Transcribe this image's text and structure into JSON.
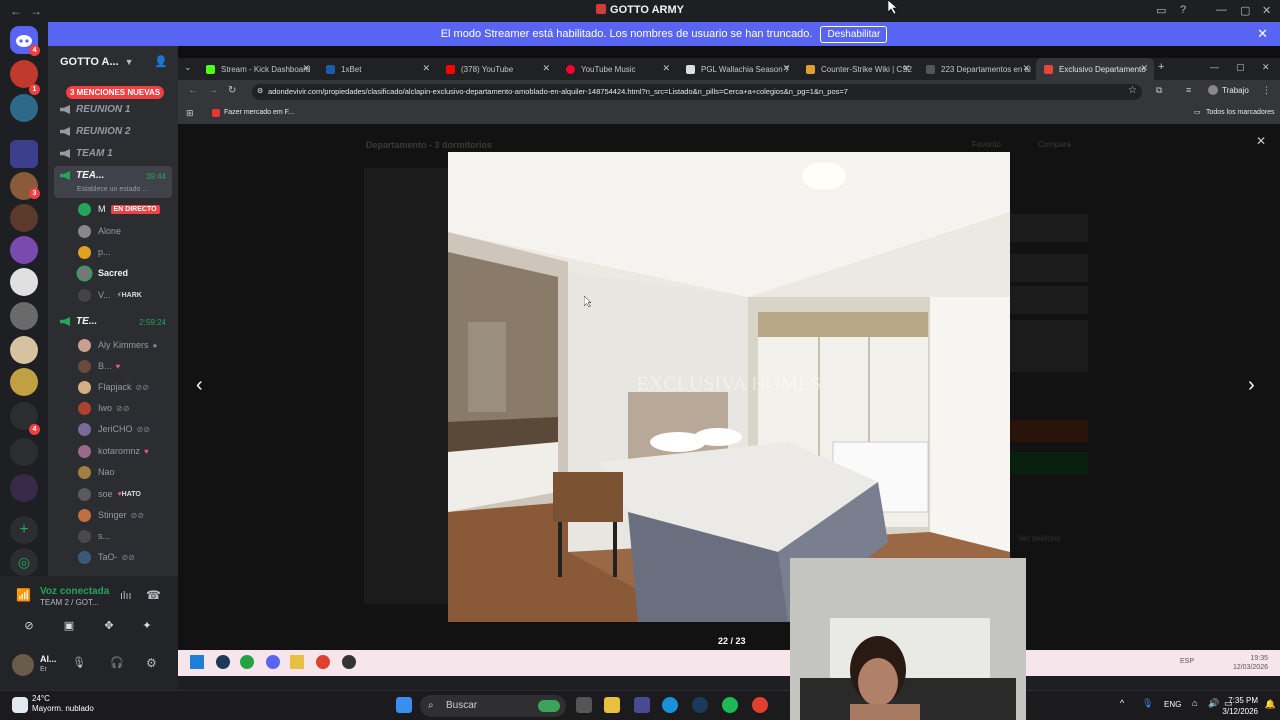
{
  "window": {
    "title": "GOTTO ARMY"
  },
  "banner": {
    "text": "El modo Streamer está habilitado. Los nombres de usuario se han truncado.",
    "button": "Deshabilitar"
  },
  "servers": {
    "badges": [
      "4",
      "1",
      "3",
      "4"
    ],
    "home_badge": "4"
  },
  "guild": {
    "name": "GOTTO A...",
    "mentions": "3 MENCIONES NUEVAS"
  },
  "voice_channels": [
    {
      "name": "REUNION 1"
    },
    {
      "name": "REUNION 2"
    },
    {
      "name": "TEAM 1"
    },
    {
      "name": "TEA...",
      "timer": "39:44",
      "status": "Establece un estado ..."
    },
    {
      "name": "TE...",
      "timer": "2:59:24"
    }
  ],
  "users_a": [
    {
      "name": "M",
      "badge": "EN DIRECTO"
    },
    {
      "name": "Alone"
    },
    {
      "name": "p..."
    },
    {
      "name": "Sacred"
    },
    {
      "name": "V...",
      "tag": "HARK"
    }
  ],
  "users_b": [
    {
      "name": "Aly Kimmers"
    },
    {
      "name": "B..."
    },
    {
      "name": "Flapjack"
    },
    {
      "name": "Iwo"
    },
    {
      "name": "JeriCHO"
    },
    {
      "name": "kotaromnz"
    },
    {
      "name": "Nao"
    },
    {
      "name": "soe",
      "tag": "HATO"
    },
    {
      "name": "Stinger"
    },
    {
      "name": "s..."
    },
    {
      "name": "TaO-"
    }
  ],
  "voice_panel": {
    "status": "Voz conectada",
    "channel": "TEAM 2 / GOT...",
    "user": "Al...",
    "user_sub": "Er"
  },
  "browser": {
    "tabs": [
      {
        "label": "Stream - Kick Dashboard",
        "color": "#53fc18"
      },
      {
        "label": "1xBet",
        "color": "#1d5cad"
      },
      {
        "label": "(378) YouTube",
        "color": "#ff0000"
      },
      {
        "label": "YouTube Music",
        "color": "#ff0033"
      },
      {
        "label": "PGL Wallachia Season 7",
        "color": "#ffffff"
      },
      {
        "label": "Counter-Strike Wiki | CS2",
        "color": "#e0a030"
      },
      {
        "label": "223 Departamentos en al",
        "color": "#444"
      },
      {
        "label": "Exclusivo Departamento",
        "color": "#e8443a"
      }
    ],
    "url": "adondevivir.com/propiedades/clasificado/alclapin-exclusivo-departamento-amoblado-en-alquiler-148754424.html?n_src=Listado&n_pills=Cerca+a+colegios&n_pg=1&n_pos=7",
    "profile": "Trabajo",
    "bookmark": "Fazer mercado em F...",
    "all_bookmarks": "Todos los marcadores"
  },
  "listing": {
    "title": "Departamento - 3 dormitorios",
    "favorite": "Favorito",
    "compare": "Compara",
    "watermark": "EXCLUSIVA HOMES",
    "counter": "22 / 23",
    "phone": "Ver teléfono"
  },
  "inner_tray": {
    "lang": "ESP",
    "time": "19:35",
    "date": "12/03/2026"
  },
  "taskbar": {
    "search": "Buscar",
    "weather_temp": "24°C",
    "weather_desc": "Mayorm. nublado",
    "lang": "ENG",
    "time": "7:35 PM",
    "date": "3/12/2026"
  }
}
